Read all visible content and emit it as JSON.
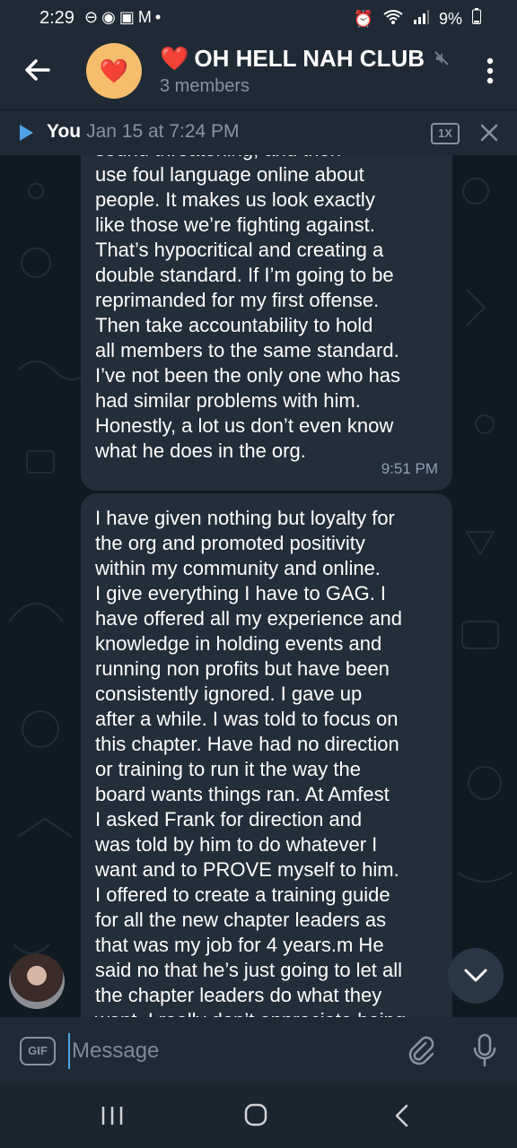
{
  "status_bar": {
    "time": "2:29",
    "left_icons": [
      "dnd-icon",
      "messenger-icon",
      "instagram-icon",
      "gmail-icon",
      "dot-icon"
    ],
    "battery": "9%"
  },
  "header": {
    "title": "OH HELL NAH CLUB",
    "title_emoji": "❤️",
    "avatar_emoji": "❤️",
    "subtitle": "3 members"
  },
  "audio_bar": {
    "sender": "You",
    "date": "Jan 15 at 7:24 PM",
    "speed": "1X"
  },
  "messages": [
    {
      "text": "sound threatening, and then\nuse foul language online about\npeople. It makes us look exactly\nlike those we’re fighting against.\nThat’s hypocritical and creating a\ndouble standard. If I’m going to be\nreprimanded for my first offense.\nThen take accountability to hold\nall members to the same standard.\nI’ve not been the only one who has\nhad similar problems with him.\nHonestly, a lot us don’t even know\nwhat he does in the org.",
      "time": "9:51 PM"
    },
    {
      "text": "I have given nothing but loyalty for\nthe org and promoted positivity\nwithin my community and online.\nI give everything I have to GAG. I\nhave offered all my experience and\nknowledge in holding events and\nrunning non profits but have been\nconsistently ignored. I gave up\nafter a while. I was told to focus on\nthis chapter. Have had no direction\nor training to run it the way the\nboard wants things ran. At Amfest\nI asked Frank for direction and\nwas told by him to do whatever I\nwant and to PROVE myself to him.\nI offered to create a training guide\nfor all the new chapter leaders as\nthat was my job for 4 years.m He\nsaid no that he’s just going to let all\nthe chapter leaders do what they\nwant. I really don’t appreciate being"
    }
  ],
  "input": {
    "placeholder": "Message",
    "gif_label": "GIF"
  },
  "colors": {
    "header_bg": "#1f2a36",
    "chat_bg": "#0f1a23",
    "bubble_bg": "#222e3a",
    "accent": "#4fa3e6",
    "muted_text": "#8593a3"
  }
}
